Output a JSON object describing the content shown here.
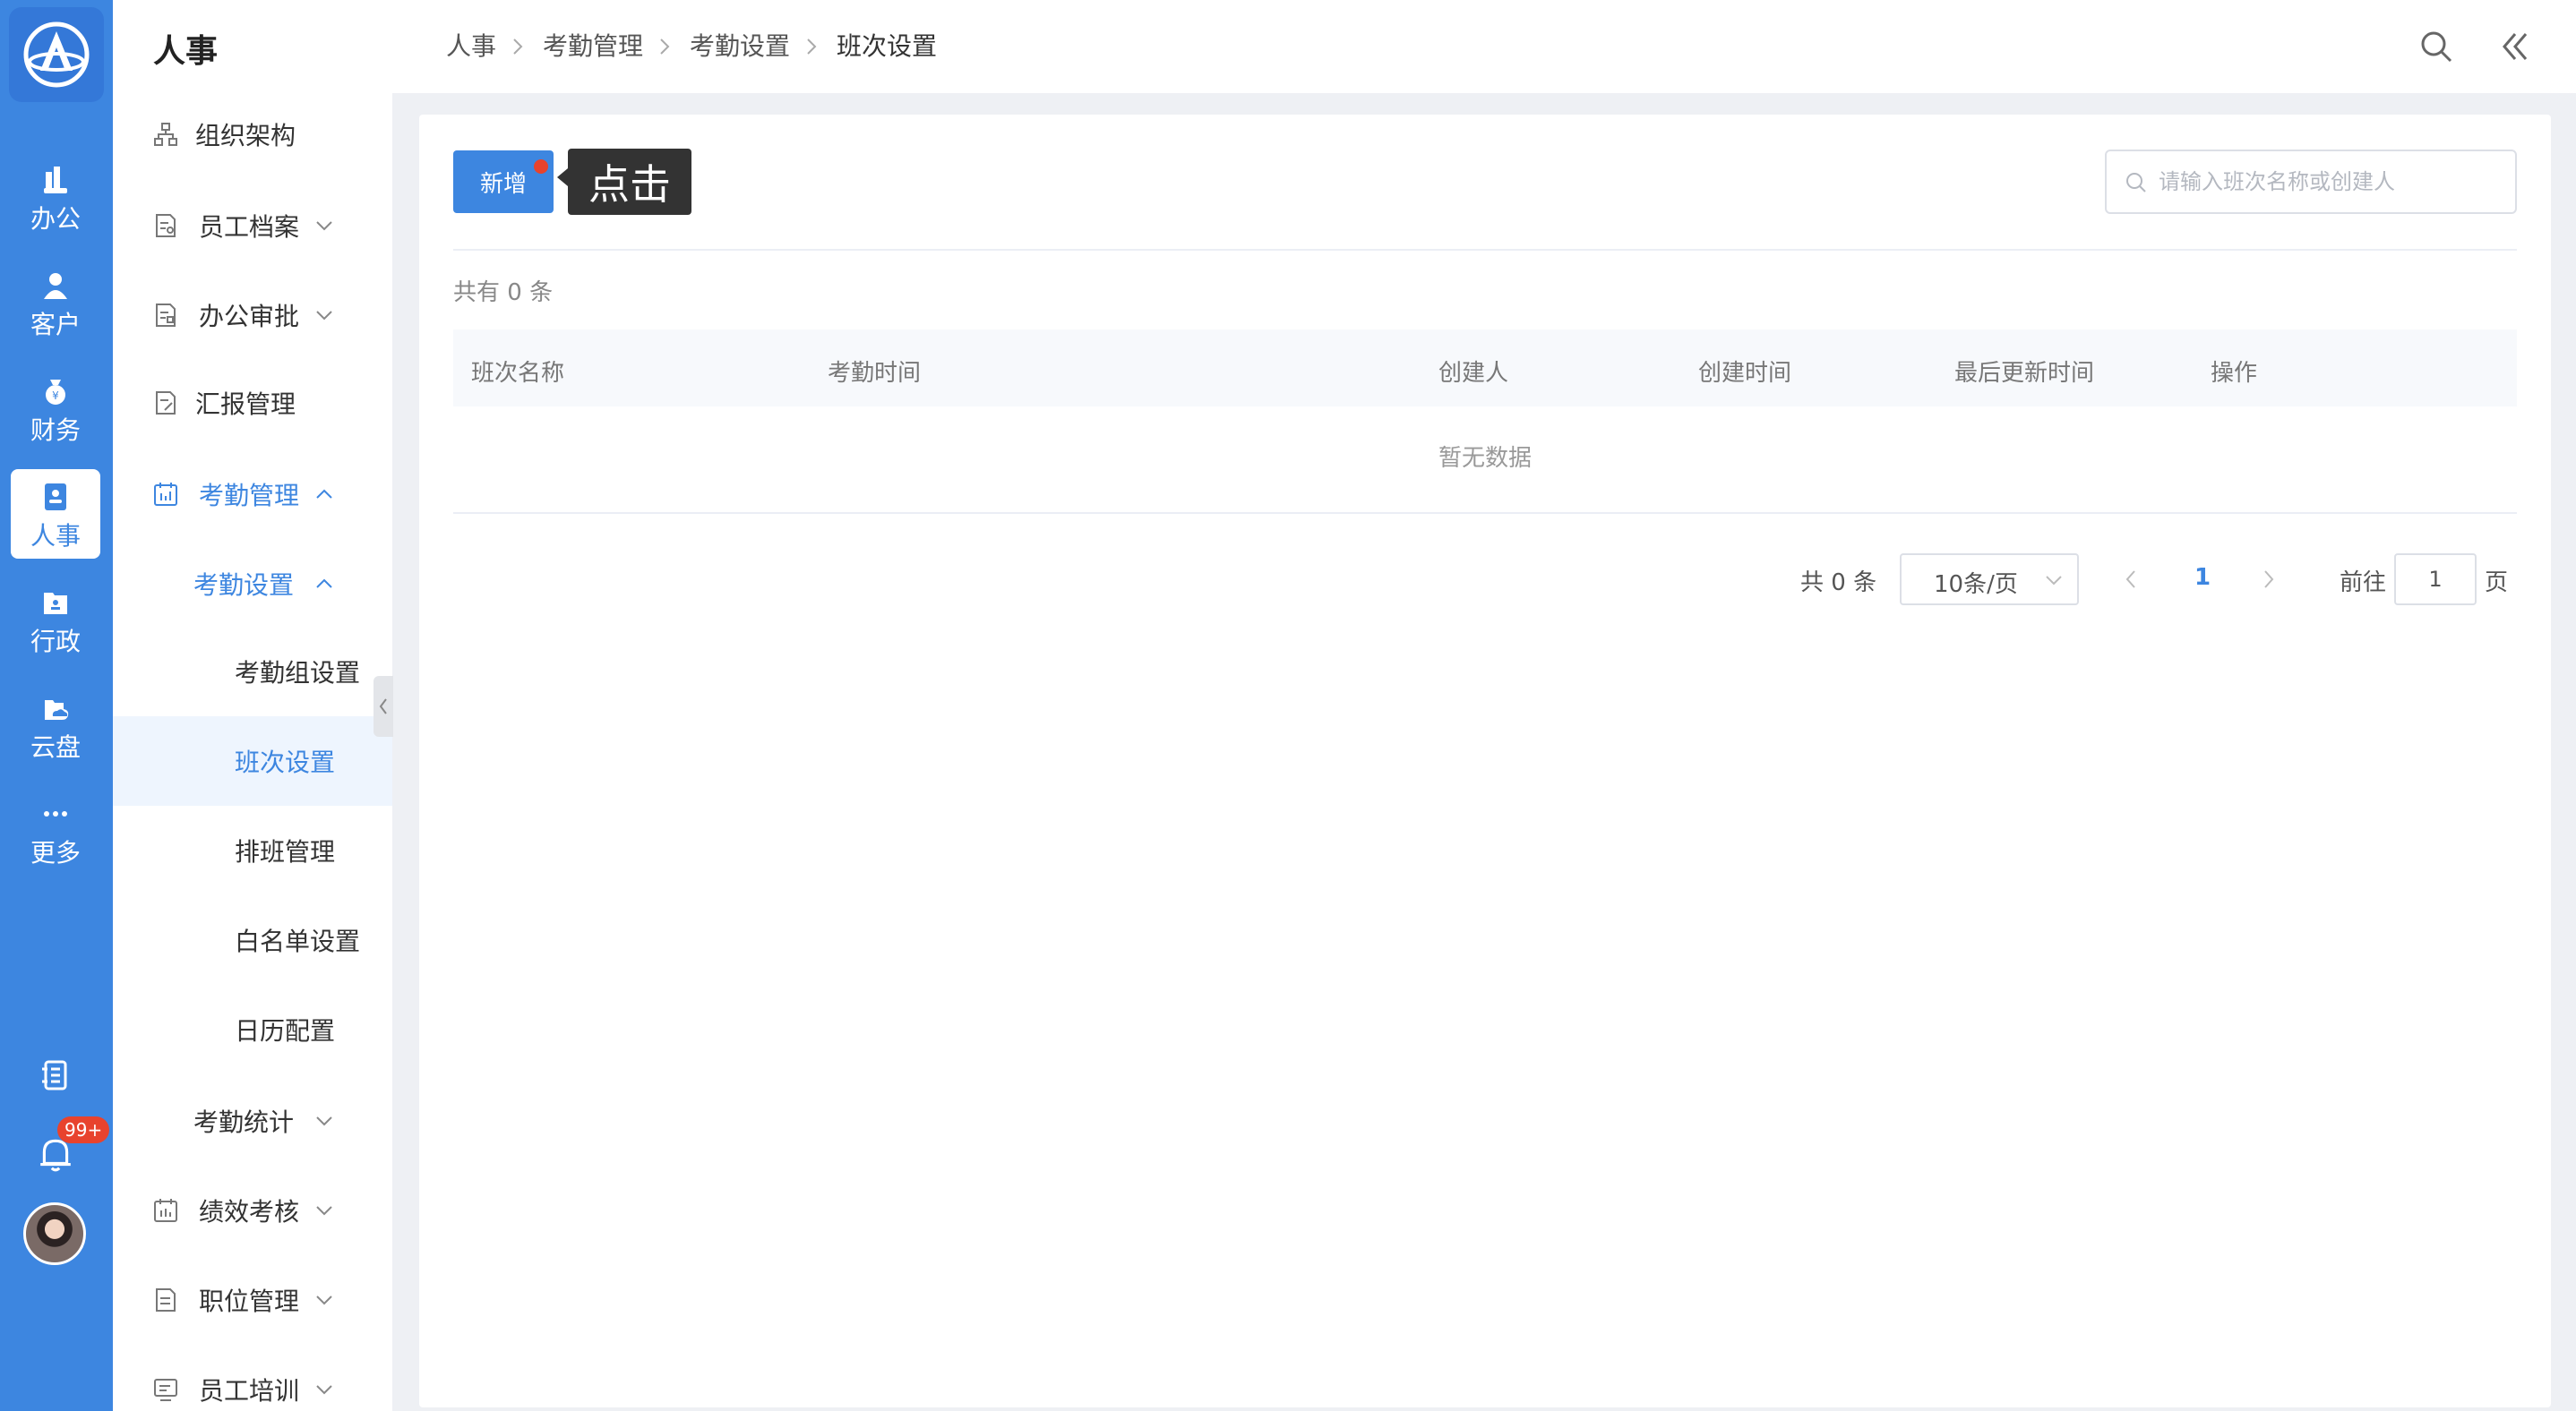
{
  "rail": {
    "items": [
      {
        "label": "办公",
        "icon": "office-icon"
      },
      {
        "label": "客户",
        "icon": "customer-icon"
      },
      {
        "label": "财务",
        "icon": "finance-icon"
      },
      {
        "label": "人事",
        "icon": "hr-icon",
        "active": true
      },
      {
        "label": "行政",
        "icon": "admin-icon"
      },
      {
        "label": "云盘",
        "icon": "cloud-icon"
      },
      {
        "label": "更多",
        "icon": "more-icon"
      }
    ],
    "notification_count": "99+"
  },
  "sidebar": {
    "title": "人事",
    "items": [
      {
        "label": "组织架构"
      },
      {
        "label": "员工档案"
      },
      {
        "label": "办公审批"
      },
      {
        "label": "汇报管理"
      },
      {
        "label": "考勤管理"
      },
      {
        "label": "考勤设置"
      },
      {
        "label": "考勤组设置"
      },
      {
        "label": "班次设置"
      },
      {
        "label": "排班管理"
      },
      {
        "label": "白名单设置"
      },
      {
        "label": "日历配置"
      },
      {
        "label": "考勤统计"
      },
      {
        "label": "绩效考核"
      },
      {
        "label": "职位管理"
      },
      {
        "label": "员工培训"
      }
    ]
  },
  "breadcrumb": [
    "人事",
    "考勤管理",
    "考勤设置",
    "班次设置"
  ],
  "main": {
    "add_button": "新增",
    "tooltip": "点击",
    "search_placeholder": "请输入班次名称或创建人",
    "total_text": "共有 0 条",
    "columns": [
      "班次名称",
      "考勤时间",
      "创建人",
      "创建时间",
      "最后更新时间",
      "操作"
    ],
    "empty_text": "暂无数据",
    "pagination": {
      "total": "共 0 条",
      "page_size": "10条/页",
      "current_page": "1",
      "goto_label": "前往",
      "goto_value": "1",
      "page_suffix": "页"
    }
  },
  "colors": {
    "accent": "#3d86e0",
    "badge": "#e8432d"
  }
}
